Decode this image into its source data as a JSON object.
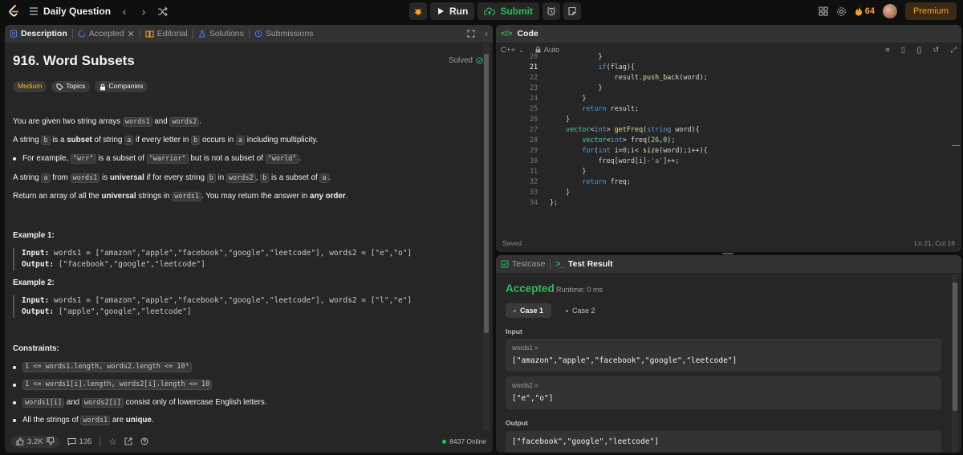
{
  "topbar": {
    "title": "Daily Question",
    "run": "Run",
    "submit": "Submit",
    "streak": "64",
    "premium": "Premium"
  },
  "desc": {
    "tabs": [
      "Description",
      "Accepted",
      "Editorial",
      "Solutions",
      "Submissions"
    ],
    "title": "916. Word Subsets",
    "solved": "Solved",
    "tags": [
      "Medium",
      "Topics",
      "Companies"
    ],
    "p1": {
      "a": "You are given two string arrays ",
      "c1": "words1",
      "b": " and ",
      "c2": "words2",
      "d": "."
    },
    "p2": {
      "a": "A string ",
      "c1": "b",
      "b": " is a ",
      "s": "subset",
      "c": " of string ",
      "c2": "a",
      "d": " if every letter in ",
      "c3": "b",
      "e": " occurs in ",
      "c4": "a",
      "f": " including multiplicity."
    },
    "p3": {
      "a": "For example, ",
      "c1": "\"wrr\"",
      "b": " is a subset of ",
      "c2": "\"warrior\"",
      "c": " but is not a subset of ",
      "c3": "\"world\"",
      "d": "."
    },
    "p4": {
      "a": "A string ",
      "c1": "a",
      "b": " from ",
      "c2": "words1",
      "c": " is ",
      "s": "universal",
      "d": " if for every string ",
      "c3": "b",
      "e": " in ",
      "c4": "words2",
      "f": ", ",
      "c5": "b",
      "g": " is a subset of ",
      "c6": "a",
      "h": "."
    },
    "p5": {
      "a": "Return an array of all the ",
      "s": "universal",
      "b": " strings in ",
      "c1": "words1",
      "c": ". You may return the answer in ",
      "s2": "any order",
      "d": "."
    },
    "ex1": {
      "h": "Example 1:",
      "in_label": "Input:",
      "in": " words1 = [\"amazon\",\"apple\",\"facebook\",\"google\",\"leetcode\"], words2 = [\"e\",\"o\"]",
      "out_label": "Output:",
      "out": " [\"facebook\",\"google\",\"leetcode\"]"
    },
    "ex2": {
      "h": "Example 2:",
      "in_label": "Input:",
      "in": " words1 = [\"amazon\",\"apple\",\"facebook\",\"google\",\"leetcode\"], words2 = [\"l\",\"e\"]",
      "out_label": "Output:",
      "out": " [\"apple\",\"google\",\"leetcode\"]"
    },
    "constraints_h": "Constraints:",
    "c1": "1 <= words1.length, words2.length <= 10⁴",
    "c2": "1 <= words1[i].length, words2[i].length <= 10",
    "c3": {
      "c1": "words1[i]",
      "a": " and ",
      "c2": "words2[i]",
      "b": " consist only of lowercase English letters."
    },
    "c4": {
      "a": "All the strings of ",
      "c1": "words1",
      "b": " are ",
      "s": "unique",
      "c": "."
    },
    "footer": {
      "likes": "3.2K",
      "comments": "135",
      "online": "8437 Online"
    }
  },
  "code": {
    "title": "Code",
    "lang": "C++",
    "auto": "Auto",
    "saved": "Saved",
    "pos": "Ln 21, Col 16",
    "line_numbers": [
      "20",
      "21",
      "22",
      "23",
      "24",
      "25",
      "26",
      "27",
      "28",
      "29",
      "30",
      "31",
      "32",
      "33",
      "34"
    ]
  },
  "test": {
    "tab1": "Testcase",
    "tab2": "Test Result",
    "status": "Accepted",
    "runtime": "Runtime: 0 ms",
    "case1": "Case 1",
    "case2": "Case 2",
    "input_label": "Input",
    "w1_label": "words1 =",
    "w1_value": "[\"amazon\",\"apple\",\"facebook\",\"google\",\"leetcode\"]",
    "w2_label": "words2 =",
    "w2_value": "[\"e\",\"o\"]",
    "output_label": "Output",
    "output_value": "[\"facebook\",\"google\",\"leetcode\"]"
  },
  "colors": {
    "accent": "#ffa116",
    "success": "#2cbb5d",
    "medium": "#ffb800"
  }
}
